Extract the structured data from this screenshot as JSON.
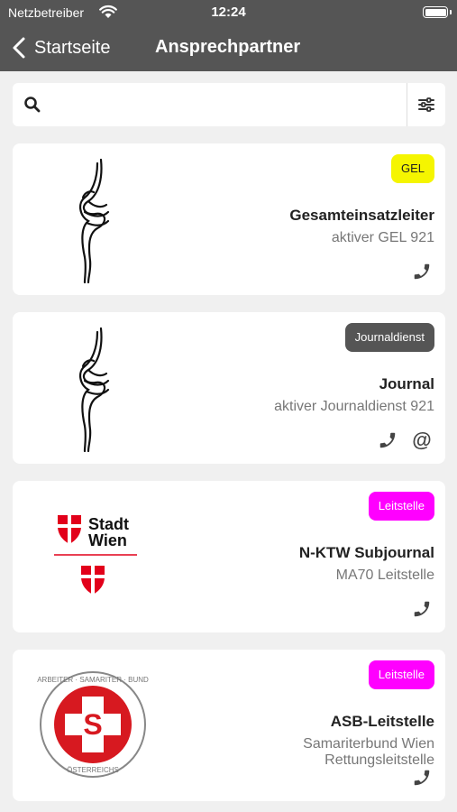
{
  "status_bar": {
    "carrier": "Netzbetreiber",
    "time": "12:24"
  },
  "nav": {
    "back_label": "Startseite",
    "title": "Ansprechpartner"
  },
  "search": {
    "placeholder": ""
  },
  "cards": [
    {
      "badge": "GEL",
      "badge_color": "#f5f500",
      "badge_text_color": "#222222",
      "title": "Gesamteinsatzleiter",
      "subtitle_lines": [
        "aktiver GEL 921"
      ],
      "logo": "knot-logo",
      "actions": [
        "phone-icon"
      ]
    },
    {
      "badge": "Journaldienst",
      "badge_color": "#555555",
      "badge_text_color": "#ffffff",
      "title": "Journal",
      "subtitle_lines": [
        "aktiver Journaldienst 921"
      ],
      "logo": "knot-logo",
      "actions": [
        "phone-icon",
        "at-icon"
      ]
    },
    {
      "badge": "Leitstelle",
      "badge_color": "#ff00ff",
      "badge_text_color": "#ffffff",
      "title": "N-KTW Subjournal",
      "subtitle_lines": [
        "MA70 Leitstelle"
      ],
      "logo": "stadt-wien-logo",
      "logo_text": [
        "Stadt",
        "Wien"
      ],
      "actions": [
        "phone-icon"
      ]
    },
    {
      "badge": "Leitstelle",
      "badge_color": "#ff00ff",
      "badge_text_color": "#ffffff",
      "title": "ASB-Leitstelle",
      "subtitle_lines": [
        "Samariterbund Wien",
        "Rettungsleitstelle"
      ],
      "logo": "asb-logo",
      "logo_text": [
        "ARBEITER · SAMARITER · BUND",
        "ÖSTERREICHS",
        "S"
      ],
      "actions": [
        "phone-icon"
      ]
    }
  ]
}
